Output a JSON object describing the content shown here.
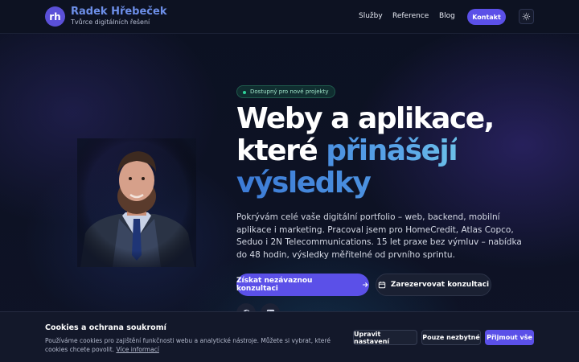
{
  "header": {
    "logo_text": "rh",
    "brand_name": "Radek Hřebeček",
    "brand_sub": "Tvůrce digitálních řešení",
    "nav": [
      "Služby",
      "Reference",
      "Blog"
    ],
    "cta": "Kontakt",
    "theme_icon": "sun-icon"
  },
  "hero": {
    "badge": "Dostupný pro nové projekty",
    "headline_1": "Weby a aplikace,",
    "headline_2a": "které ",
    "headline_2b": "přinášejí",
    "headline_3": "výsledky",
    "lead": "Pokrývám celé vaše digitální portfolio – web, backend, mobilní aplikace i marketing. Pracoval jsem pro HomeCredit, Atlas Copco, Seduo i 2N Telecommunications. 15 let praxe bez výmluv – nabídka do 48 hodin, výsledky měřitelné od prvního sprintu.",
    "primary_button": "Získat nezávaznou konzultaci",
    "secondary_button": "Zarezervovat konzultaci",
    "social": [
      "facebook-icon",
      "linkedin-icon"
    ]
  },
  "cookie": {
    "title": "Cookies a ochrana soukromí",
    "text": "Používáme cookies pro zajištění funkčnosti webu a analytické nástroje. Můžete si vybrat, které cookies chcete povolit.",
    "link": "Více informací",
    "btn_settings": "Upravit nastavení",
    "btn_necessary": "Pouze nezbytné",
    "btn_accept": "Přijmout vše"
  },
  "colors": {
    "accent": "#5b50e8",
    "brand_text": "#6d8fe9",
    "background": "#0c1122"
  }
}
